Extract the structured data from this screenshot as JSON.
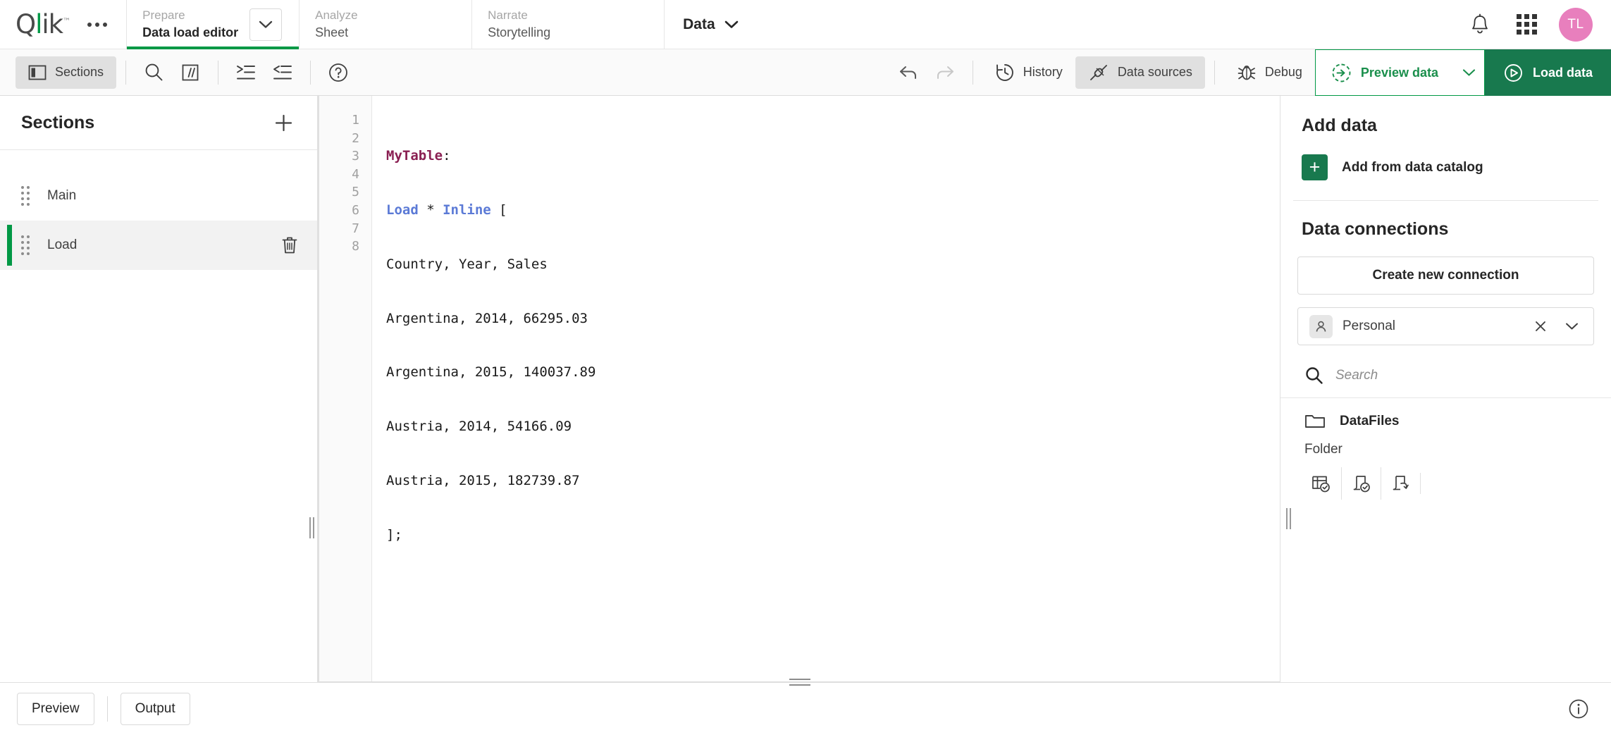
{
  "header": {
    "logo": {
      "q": "Q",
      "l": "l",
      "ik": "ik",
      "tm": "™"
    },
    "more_label": "more-options",
    "tabs": [
      {
        "top": "Prepare",
        "bottom": "Data load editor",
        "active": true
      },
      {
        "top": "Analyze",
        "bottom": "Sheet",
        "active": false
      },
      {
        "top": "Narrate",
        "bottom": "Storytelling",
        "active": false
      }
    ],
    "data_menu": "Data",
    "avatar_initials": "TL"
  },
  "toolbar": {
    "sections_label": "Sections",
    "search_icon": "search-icon",
    "comment_icon": "comment-icon",
    "indent_icon": "indent-icon",
    "outdent_icon": "outdent-icon",
    "help_icon": "help-icon",
    "undo_icon": "undo-icon",
    "redo_icon": "redo-icon",
    "history_label": "History",
    "data_sources_label": "Data sources",
    "debug_label": "Debug",
    "preview_data_label": "Preview data",
    "load_data_label": "Load data"
  },
  "sections": {
    "title": "Sections",
    "add_label": "+",
    "items": [
      {
        "label": "Main",
        "selected": false
      },
      {
        "label": "Load",
        "selected": true
      }
    ]
  },
  "editor": {
    "lines": [
      {
        "num": "1",
        "tokens": [
          {
            "t": "MyTable",
            "c": "tok-table"
          },
          {
            "t": ":",
            "c": "tok-plain"
          }
        ]
      },
      {
        "num": "2",
        "tokens": [
          {
            "t": "Load",
            "c": "tok-kw"
          },
          {
            "t": " * ",
            "c": "tok-plain"
          },
          {
            "t": "Inline",
            "c": "tok-kw"
          },
          {
            "t": " [",
            "c": "tok-plain"
          }
        ]
      },
      {
        "num": "3",
        "tokens": [
          {
            "t": "Country, Year, Sales",
            "c": "tok-plain"
          }
        ]
      },
      {
        "num": "4",
        "tokens": [
          {
            "t": "Argentina, 2014, 66295.03",
            "c": "tok-plain"
          }
        ]
      },
      {
        "num": "5",
        "tokens": [
          {
            "t": "Argentina, 2015, 140037.89",
            "c": "tok-plain"
          }
        ]
      },
      {
        "num": "6",
        "tokens": [
          {
            "t": "Austria, 2014, 54166.09",
            "c": "tok-plain"
          }
        ]
      },
      {
        "num": "7",
        "tokens": [
          {
            "t": "Austria, 2015, 182739.87",
            "c": "tok-plain"
          }
        ]
      },
      {
        "num": "8",
        "tokens": [
          {
            "t": "];",
            "c": "tok-plain"
          }
        ]
      }
    ]
  },
  "right_panel": {
    "add_data_title": "Add data",
    "add_from_catalog": "Add from data catalog",
    "data_connections_title": "Data connections",
    "create_new_connection": "Create new connection",
    "space": {
      "name": "Personal",
      "clear_icon": "close-icon",
      "chevron_icon": "chevron-down-icon"
    },
    "search_placeholder": "Search",
    "connection": {
      "name": "DataFiles",
      "type": "Folder",
      "actions": [
        "select-data-icon",
        "insert-script-icon",
        "edit-connection-icon"
      ]
    }
  },
  "footer": {
    "preview_label": "Preview",
    "output_label": "Output",
    "info_icon": "info-icon"
  },
  "colors": {
    "brand_green": "#009845",
    "load_button_green": "#18794e",
    "avatar_pink": "#e87fbd",
    "token_table": "#8a1f52",
    "token_keyword": "#5b7ad6"
  }
}
